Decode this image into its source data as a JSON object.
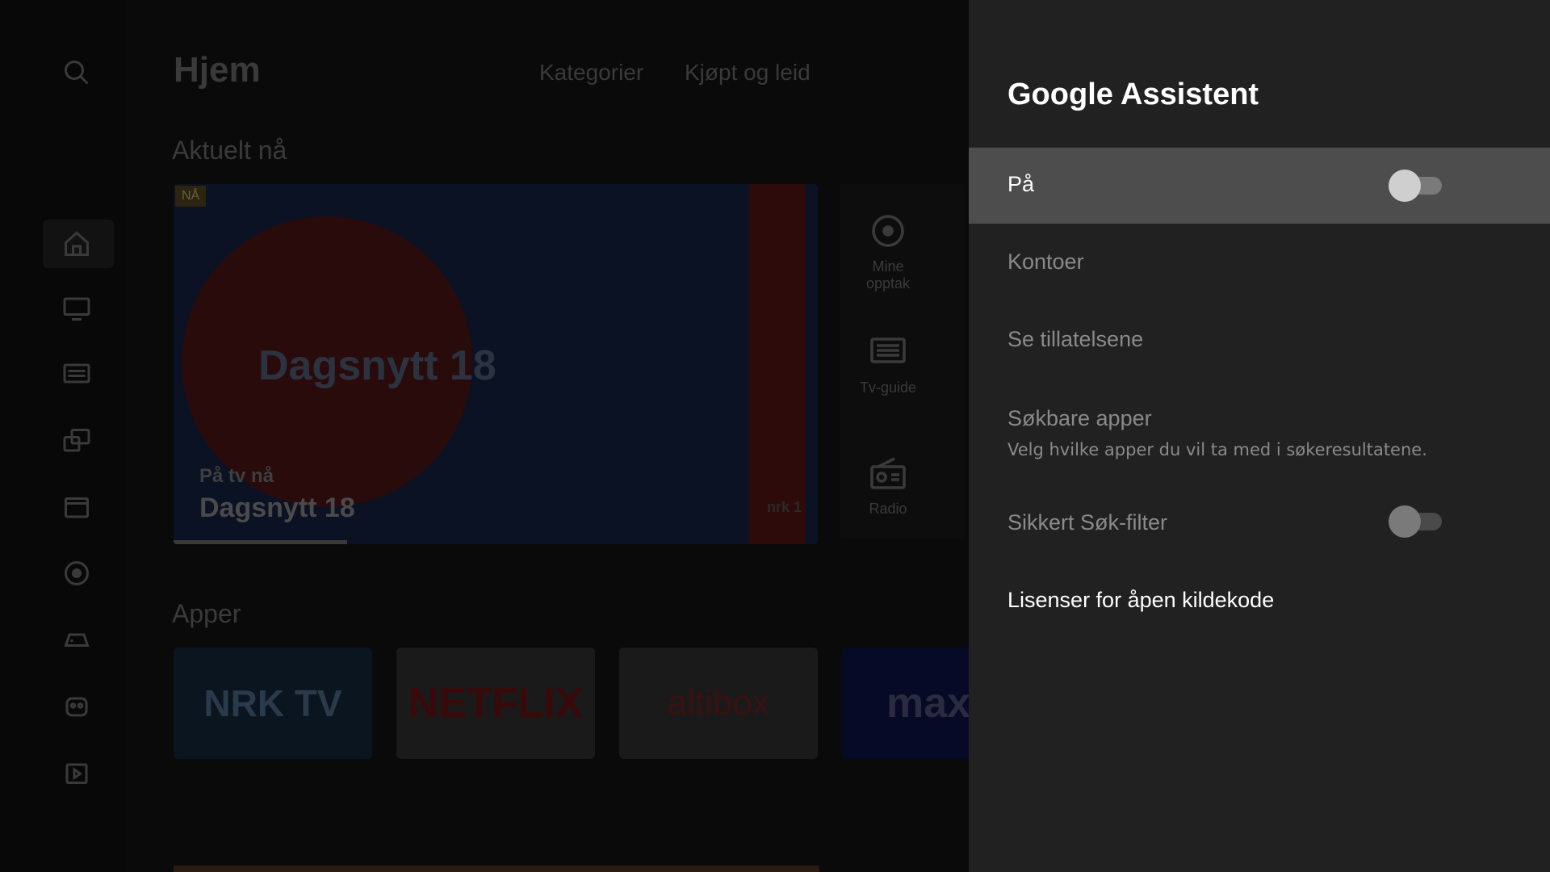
{
  "launcher": {
    "title": "Hjem",
    "nav": [
      "Kategorier",
      "Kjøpt og leid"
    ],
    "now_section": "Aktuelt nå",
    "hero": {
      "badge": "NÅ",
      "overlay_title": "Dagsnytt 18",
      "subtitle": "På tv nå",
      "program": "Dagsnytt 18",
      "channel_logo": "nrk 1",
      "progress": 0.27
    },
    "tiles": [
      {
        "label": "Mine opptak",
        "icon": "record-icon"
      },
      {
        "label": "Tv-guide",
        "icon": "tv-guide-icon"
      },
      {
        "label": "Radio",
        "icon": "radio-icon"
      }
    ],
    "apps_section": "Apper",
    "apps": [
      "NRK TV",
      "NETFLIX",
      "altibox",
      "max"
    ],
    "side_icons": [
      "search-icon",
      "home-icon",
      "tv-icon",
      "guide-icon",
      "devices-icon",
      "movies-icon",
      "record-icon",
      "games-icon",
      "kids-icon",
      "play-store-icon"
    ]
  },
  "panel": {
    "title": "Google Assistent",
    "items": [
      {
        "label": "På",
        "toggle": true,
        "toggle_on": false
      },
      {
        "label": "Kontoer"
      },
      {
        "label": "Se tillatelsene"
      },
      {
        "label": "Søkbare apper",
        "sublabel": "Velg hvilke apper du vil ta med i søkeresultatene."
      },
      {
        "label": "Sikkert Søk-filter",
        "toggle": true,
        "toggle_on": false
      },
      {
        "label": "Lisenser for åpen kildekode"
      }
    ]
  },
  "colors": {
    "panel_bg": "#212121",
    "selected_row": "#4d4d4d",
    "disabled_text": "#8a8a8a",
    "enabled_text": "#ffffff"
  }
}
